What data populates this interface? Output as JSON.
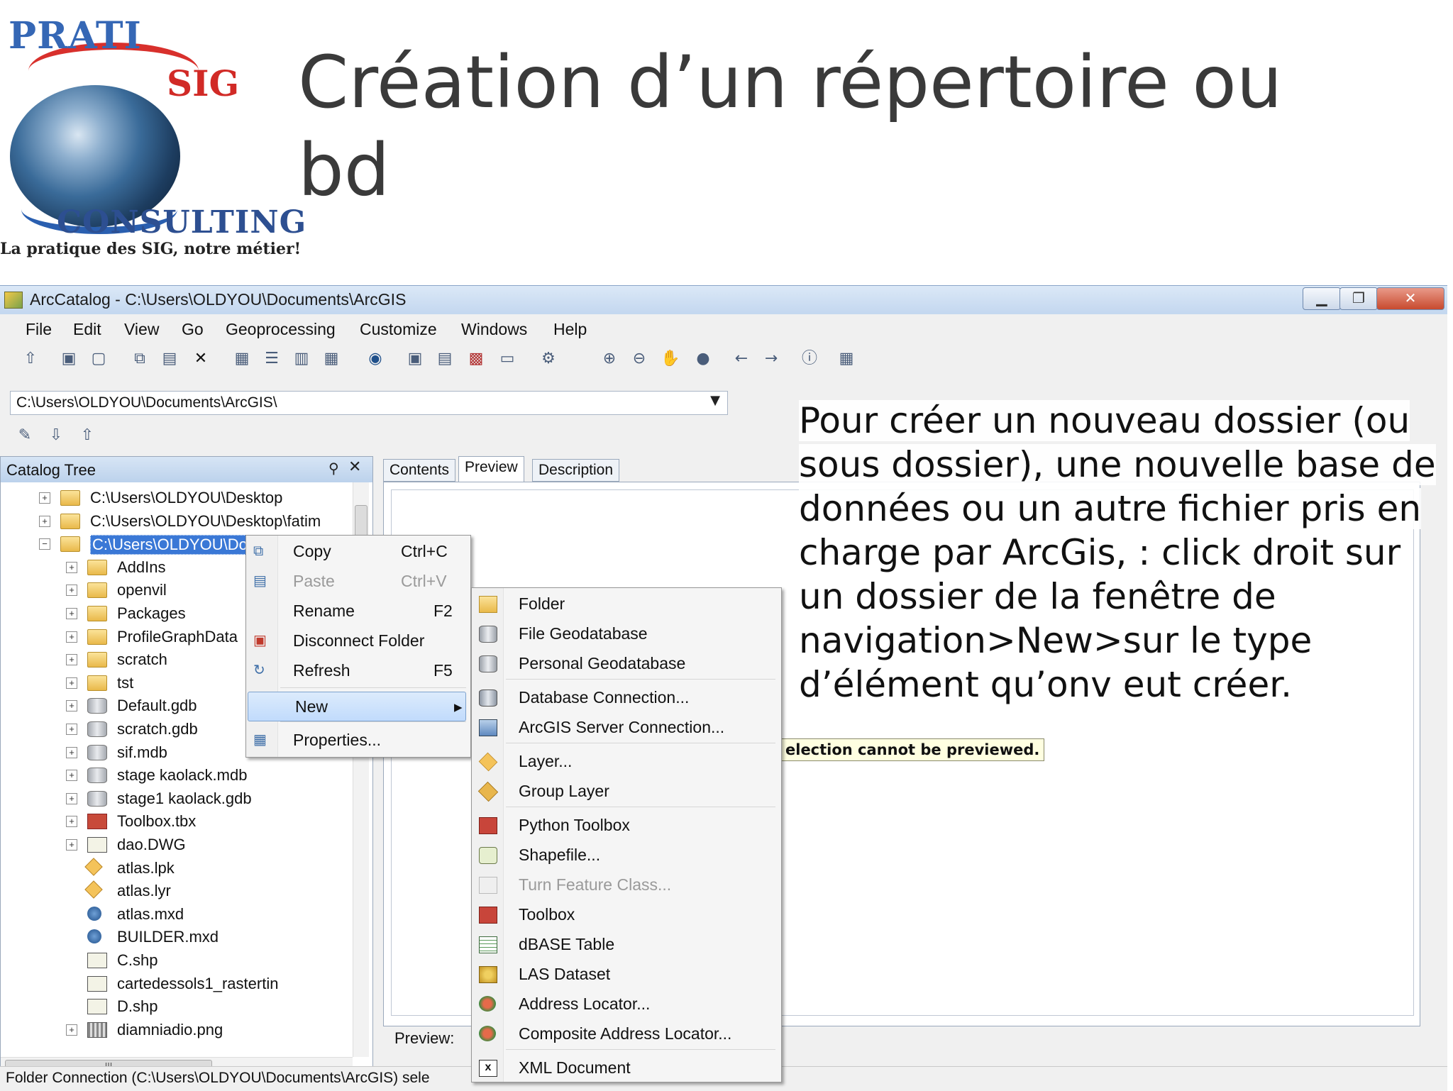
{
  "slide": {
    "title": "Création d’un répertoire ou bd",
    "logo": {
      "brand_top": "PRATI",
      "brand_mid": "SIG",
      "brand_bottom": "CONSULTING",
      "tagline": "La pratique des SIG, notre métier!"
    },
    "instruction": "Pour créer un nouveau dossier (ou sous dossier), une nouvelle base de données ou un autre fichier pris en charge par ArcGis, : click droit sur un dossier de la fenêtre de navigation>New>sur le type d’élément qu’onv eut créer."
  },
  "window": {
    "title": "ArcCatalog - C:\\Users\\OLDYOU\\Documents\\ArcGIS",
    "buttons": {
      "minimize": "▁",
      "maximize": "❐",
      "close": "✕"
    }
  },
  "menu": [
    "File",
    "Edit",
    "View",
    "Go",
    "Geoprocessing",
    "Customize",
    "Windows",
    "Help"
  ],
  "toolbar1_icons": [
    "up-folder-icon",
    "connect-folder-icon",
    "disconnect-folder-icon",
    "copy-icon",
    "paste-icon",
    "delete-icon",
    "large-icons-icon",
    "list-icon",
    "details-icon",
    "thumbnails-icon",
    "launch-arcmap-icon",
    "catalog-tree-icon",
    "search-window-icon",
    "arctoolbox-icon",
    "python-window-icon",
    "model-builder-icon",
    "zoom-in-icon",
    "zoom-out-icon",
    "pan-icon",
    "full-extent-icon",
    "back-icon",
    "forward-icon",
    "identify-icon",
    "create-thumbnail-icon"
  ],
  "address": {
    "value": "C:\\Users\\OLDYOU\\Documents\\ArcGIS\\"
  },
  "catalog_tree": {
    "title": "Catalog Tree",
    "rows": [
      {
        "label": "C:\\Users\\OLDYOU\\Desktop",
        "level": 0,
        "expander": "+",
        "icon": "folder"
      },
      {
        "label": "C:\\Users\\OLDYOU\\Desktop\\fatim",
        "level": 0,
        "expander": "+",
        "icon": "folder"
      },
      {
        "label": "C:\\Users\\OLDYOU\\Documents\\Ar",
        "level": 0,
        "expander": "−",
        "icon": "folder",
        "selected": true
      },
      {
        "label": "AddIns",
        "level": 1,
        "expander": "+",
        "icon": "folder"
      },
      {
        "label": "openvil",
        "level": 1,
        "expander": "+",
        "icon": "folder"
      },
      {
        "label": "Packages",
        "level": 1,
        "expander": "+",
        "icon": "folder"
      },
      {
        "label": "ProfileGraphData",
        "level": 1,
        "expander": "+",
        "icon": "folder"
      },
      {
        "label": "scratch",
        "level": 1,
        "expander": "+",
        "icon": "folder"
      },
      {
        "label": "tst",
        "level": 1,
        "expander": "+",
        "icon": "folder"
      },
      {
        "label": "Default.gdb",
        "level": 1,
        "expander": "+",
        "icon": "gdb"
      },
      {
        "label": "scratch.gdb",
        "level": 1,
        "expander": "+",
        "icon": "gdb"
      },
      {
        "label": "sif.mdb",
        "level": 1,
        "expander": "+",
        "icon": "gdb"
      },
      {
        "label": "stage kaolack.mdb",
        "level": 1,
        "expander": "+",
        "icon": "gdb"
      },
      {
        "label": "stage1 kaolack.gdb",
        "level": 1,
        "expander": "+",
        "icon": "gdb"
      },
      {
        "label": "Toolbox.tbx",
        "level": 1,
        "expander": "+",
        "icon": "toolbox"
      },
      {
        "label": "dao.DWG",
        "level": 1,
        "expander": "+",
        "icon": "shp"
      },
      {
        "label": "atlas.lpk",
        "level": 1,
        "expander": "",
        "icon": "lyr"
      },
      {
        "label": "atlas.lyr",
        "level": 1,
        "expander": "",
        "icon": "lyr"
      },
      {
        "label": "atlas.mxd",
        "level": 1,
        "expander": "",
        "icon": "mxd"
      },
      {
        "label": "BUILDER.mxd",
        "level": 1,
        "expander": "",
        "icon": "mxd"
      },
      {
        "label": "C.shp",
        "level": 1,
        "expander": "",
        "icon": "shp"
      },
      {
        "label": "cartedessols1_rastertin",
        "level": 1,
        "expander": "",
        "icon": "shp"
      },
      {
        "label": "D.shp",
        "level": 1,
        "expander": "",
        "icon": "shp"
      },
      {
        "label": "diamniadio.png",
        "level": 1,
        "expander": "+",
        "icon": "png"
      }
    ]
  },
  "tabs": [
    "Contents",
    "Preview",
    "Description"
  ],
  "preview": {
    "message": "election cannot be previewed.",
    "label": "Preview:"
  },
  "status": "Folder Connection (C:\\Users\\OLDYOU\\Documents\\ArcGIS) sele",
  "context_menu": [
    {
      "label": "Copy",
      "shortcut": "Ctrl+C",
      "icon": "copy-icon",
      "disabled": false
    },
    {
      "label": "Paste",
      "shortcut": "Ctrl+V",
      "icon": "paste-icon",
      "disabled": true
    },
    {
      "label": "Rename",
      "shortcut": "F2",
      "icon": "",
      "disabled": false
    },
    {
      "label": "Disconnect Folder",
      "shortcut": "",
      "icon": "disconnect-folder-icon",
      "disabled": false
    },
    {
      "label": "Refresh",
      "shortcut": "F5",
      "icon": "refresh-icon",
      "disabled": false
    },
    {
      "label": "New",
      "shortcut": "▸",
      "icon": "",
      "disabled": false,
      "highlighted": true
    },
    {
      "label": "Properties...",
      "shortcut": "",
      "icon": "properties-icon",
      "disabled": false
    }
  ],
  "new_submenu": [
    {
      "label": "Folder",
      "icon": "folder-icon",
      "disabled": false
    },
    {
      "label": "File Geodatabase",
      "icon": "file-geodatabase-icon",
      "disabled": false
    },
    {
      "label": "Personal Geodatabase",
      "icon": "personal-geodatabase-icon",
      "disabled": false
    },
    {
      "label": "Database Connection...",
      "icon": "database-connection-icon",
      "disabled": false
    },
    {
      "label": "ArcGIS Server Connection...",
      "icon": "server-connection-icon",
      "disabled": false
    },
    {
      "label": "Layer...",
      "icon": "layer-icon",
      "disabled": false
    },
    {
      "label": "Group Layer",
      "icon": "group-layer-icon",
      "disabled": false
    },
    {
      "label": "Python Toolbox",
      "icon": "python-toolbox-icon",
      "disabled": false
    },
    {
      "label": "Shapefile...",
      "icon": "shapefile-icon",
      "disabled": false
    },
    {
      "label": "Turn Feature Class...",
      "icon": "turn-feature-class-icon",
      "disabled": true
    },
    {
      "label": "Toolbox",
      "icon": "toolbox-icon",
      "disabled": false
    },
    {
      "label": "dBASE Table",
      "icon": "dbase-table-icon",
      "disabled": false
    },
    {
      "label": "LAS Dataset",
      "icon": "las-dataset-icon",
      "disabled": false
    },
    {
      "label": "Address Locator...",
      "icon": "address-locator-icon",
      "disabled": false
    },
    {
      "label": "Composite Address Locator...",
      "icon": "composite-address-locator-icon",
      "disabled": false
    },
    {
      "label": "XML Document",
      "icon": "xml-document-icon",
      "disabled": false
    }
  ]
}
